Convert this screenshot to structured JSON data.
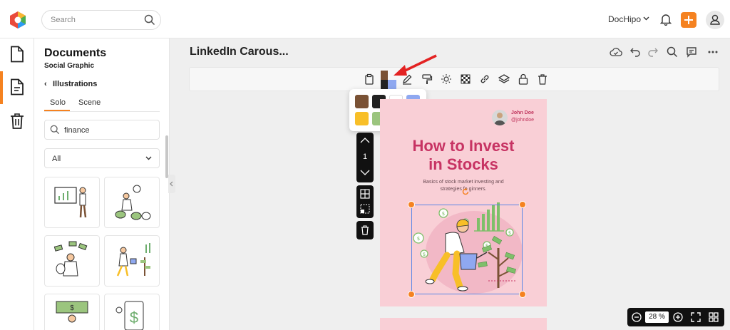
{
  "header": {
    "search_placeholder": "Search",
    "brand_label": "DocHipo",
    "accent_color": "#f58220"
  },
  "panel": {
    "title": "Documents",
    "subtitle": "Social Graphic",
    "back_label": "Illustrations",
    "tabs": [
      {
        "label": "Solo",
        "active": true
      },
      {
        "label": "Scene",
        "active": false
      }
    ],
    "search_value": "finance",
    "filter_value": "All",
    "thumbnails": [
      "illustration-chart-presenter",
      "illustration-money-bags",
      "illustration-money-rain",
      "illustration-watering-money-plant",
      "illustration-money-banner",
      "illustration-dollar-scan"
    ]
  },
  "document": {
    "title": "LinkedIn Carous..."
  },
  "color_picker": {
    "swatches": [
      "#7a5235",
      "#222222",
      "#ffffff",
      "#8fa8f0",
      "#f8bf28",
      "#9bc57e"
    ]
  },
  "page_tools": {
    "page_number": "1"
  },
  "slide": {
    "author_name": "John Doe",
    "author_handle": "@johndoe",
    "headline_line1": "How to Invest",
    "headline_line2": "in Stocks",
    "subtitle_line1": "Basics of stock market investing and",
    "subtitle_line2": "strategies fo   ginners.",
    "background_color": "#f9cfd6",
    "headline_color": "#c73363"
  },
  "zoom": {
    "value": "28",
    "unit": "%"
  }
}
